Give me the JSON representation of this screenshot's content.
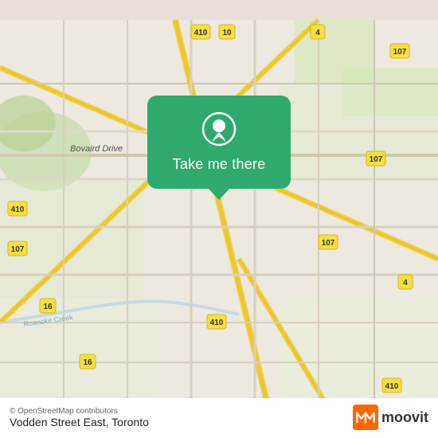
{
  "map": {
    "background_color": "#e8ddd0",
    "attribution": "© OpenStreetMap contributors"
  },
  "popup": {
    "button_label": "Take me there",
    "pin_color": "#ffffff"
  },
  "bottom_bar": {
    "osm_credit": "© OpenStreetMap contributors",
    "location_name": "Vodden Street East, Toronto",
    "moovit_label": "moovit"
  },
  "road_labels": {
    "bovaird_drive": "Bovaird Drive",
    "roanoke_creek": "Roanoke Creek",
    "highway_410": "410",
    "highway_107_1": "107",
    "highway_107_2": "107",
    "highway_107_3": "107",
    "highway_4_1": "4",
    "highway_4_2": "4",
    "highway_10": "10",
    "highway_16_1": "16",
    "highway_16_2": "16",
    "highway_410_bottom": "410",
    "highway_410_mid": "410"
  }
}
